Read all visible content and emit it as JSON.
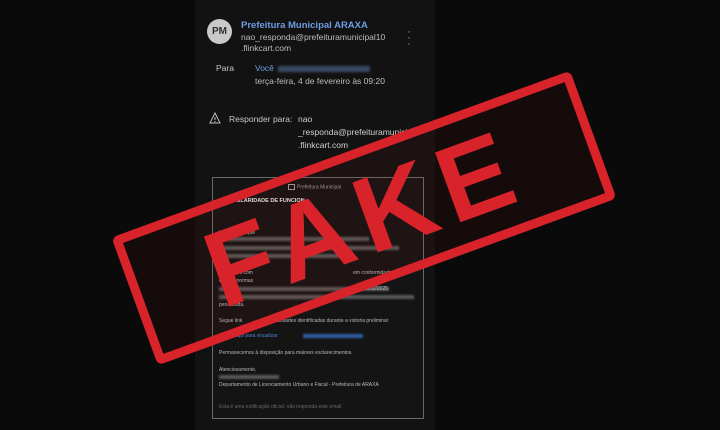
{
  "email": {
    "avatar_initials": "PM",
    "sender_name": "Prefeitura Municipal ARAXA",
    "sender_email_line1": "nao_responda@prefeituramunicipal10",
    "sender_email_line2": ".flinkcart.com",
    "more_icon": "more-vertical-icon",
    "to_label": "Para",
    "to_value": "Você",
    "date": "terça-feira, 4 de fevereiro às 09:20",
    "warning_icon": "warning-triangle-icon",
    "reply_label": "Responder para:",
    "reply_line1": "nao",
    "reply_line2": "_responda@prefeituramunicipa",
    "reply_line3": ".flinkcart.com"
  },
  "body": {
    "image_alt": "Prefeitura Municipal",
    "subject_partial": "IRREGULARIDADE",
    "subject_partial2": "DE FUNCION",
    "p1": "Informamos que",
    "p1_link": "ARAXA",
    "p2": "De acordo com",
    "p2_b": "em conformidade",
    "p2_c": "com as normas",
    "p2_date": "03/02/2025",
    "p2_d": "penalizada.",
    "p3": "Segue link",
    "p3_b": "irregularidades identificadas durante a vistoria preliminar",
    "link_label": "Clique aqui para visualizar",
    "p4": "Permanecemos à disposição para maiores esclarecimentos.",
    "closing": "Atenciosamente,",
    "dept": "Departamento de Licenciamento Urbano e Fiscal - Prefeitura de ARAXA",
    "footer": "Esta é uma notificação oficial, não responda este email."
  },
  "stamp": {
    "text": "FAKE",
    "color": "#d8232a"
  }
}
